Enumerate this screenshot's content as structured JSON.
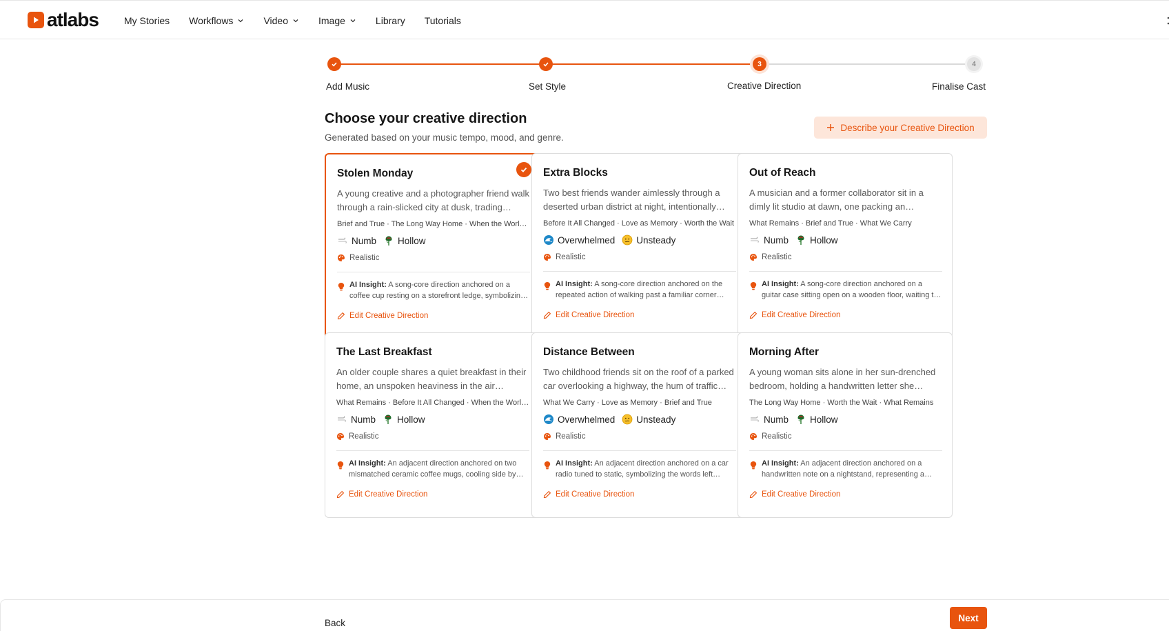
{
  "brand": {
    "name": "atlabs"
  },
  "nav": {
    "items": [
      {
        "label": "My Stories",
        "dropdown": false
      },
      {
        "label": "Workflows",
        "dropdown": true
      },
      {
        "label": "Video",
        "dropdown": true
      },
      {
        "label": "Image",
        "dropdown": true
      },
      {
        "label": "Library",
        "dropdown": false
      },
      {
        "label": "Tutorials",
        "dropdown": false
      }
    ]
  },
  "stepper": {
    "steps": [
      {
        "label": "Add Music",
        "state": "done",
        "number": "1"
      },
      {
        "label": "Set Style",
        "state": "done",
        "number": "2"
      },
      {
        "label": "Creative Direction",
        "state": "active",
        "number": "3"
      },
      {
        "label": "Finalise Cast",
        "state": "todo",
        "number": "4"
      }
    ]
  },
  "header": {
    "title": "Choose your creative direction",
    "subtitle": "Generated based on your music tempo, mood, and genre.",
    "describe_button": "Describe your Creative Direction"
  },
  "cards": [
    {
      "title": "Stolen Monday",
      "selected": true,
      "description": "A young creative and a photographer friend walk through a rain-slicked city at dusk, trading stories and stolen glances.",
      "songs": "Brief and True · The Long Way Home · When the World Stood Still",
      "moods": [
        {
          "label": "Numb",
          "icon": "wind-icon"
        },
        {
          "label": "Hollow",
          "icon": "wilted-rose-icon"
        }
      ],
      "style": "Realistic",
      "insight_label": "AI Insight:",
      "insight": "A song-core direction anchored on a coffee cup resting on a storefront ledge, symbolizing a moment held too long.",
      "edit_label": "Edit Creative Direction"
    },
    {
      "title": "Extra Blocks",
      "selected": false,
      "description": "Two best friends wander aimlessly through a deserted urban district at night, intentionally taking the long way home.",
      "songs": "Before It All Changed · Love as Memory · Worth the Wait",
      "moods": [
        {
          "label": "Overwhelmed",
          "icon": "wave-icon"
        },
        {
          "label": "Unsteady",
          "icon": "face-icon"
        }
      ],
      "style": "Realistic",
      "insight_label": "AI Insight:",
      "insight": "A song-core direction anchored on the repeated action of walking past a familiar corner without stopping.",
      "edit_label": "Edit Creative Direction"
    },
    {
      "title": "Out of Reach",
      "selected": false,
      "description": "A musician and a former collaborator sit in a dimly lit studio at dawn, one packing an instrument away for good.",
      "songs": "What Remains · Brief and True · What We Carry",
      "moods": [
        {
          "label": "Numb",
          "icon": "wind-icon"
        },
        {
          "label": "Hollow",
          "icon": "wilted-rose-icon"
        }
      ],
      "style": "Realistic",
      "insight_label": "AI Insight:",
      "insight": "A song-core direction anchored on a guitar case sitting open on a wooden floor, waiting to be closed.",
      "edit_label": "Edit Creative Direction"
    },
    {
      "title": "The Last Breakfast",
      "selected": false,
      "description": "An older couple shares a quiet breakfast in their home, an unspoken heaviness in the air between them.",
      "songs": "What Remains · Before It All Changed · When the World Stood Still",
      "moods": [
        {
          "label": "Numb",
          "icon": "wind-icon"
        },
        {
          "label": "Hollow",
          "icon": "wilted-rose-icon"
        }
      ],
      "style": "Realistic",
      "insight_label": "AI Insight:",
      "insight": "An adjacent direction anchored on two mismatched ceramic coffee mugs, cooling side by side on the table.",
      "edit_label": "Edit Creative Direction"
    },
    {
      "title": "Distance Between",
      "selected": false,
      "description": "Two childhood friends sit on the roof of a parked car overlooking a highway, the hum of traffic below them.",
      "songs": "What We Carry · Love as Memory · Brief and True",
      "moods": [
        {
          "label": "Overwhelmed",
          "icon": "wave-icon"
        },
        {
          "label": "Unsteady",
          "icon": "face-icon"
        }
      ],
      "style": "Realistic",
      "insight_label": "AI Insight:",
      "insight": "An adjacent direction anchored on a car radio tuned to static, symbolizing the words left unsaid.",
      "edit_label": "Edit Creative Direction"
    },
    {
      "title": "Morning After",
      "selected": false,
      "description": "A young woman sits alone in her sun-drenched bedroom, holding a handwritten letter she cannot bring herself to read.",
      "songs": "The Long Way Home · Worth the Wait · What Remains",
      "moods": [
        {
          "label": "Numb",
          "icon": "wind-icon"
        },
        {
          "label": "Hollow",
          "icon": "wilted-rose-icon"
        }
      ],
      "style": "Realistic",
      "insight_label": "AI Insight:",
      "insight": "An adjacent direction anchored on a handwritten note on a nightstand, representing a goodbye in waiting.",
      "edit_label": "Edit Creative Direction"
    }
  ],
  "footer": {
    "back_label": "Back",
    "next_label": "Next"
  },
  "colors": {
    "accent": "#e8540e",
    "accent_soft": "#fde6da",
    "border": "#dcdcdc"
  }
}
